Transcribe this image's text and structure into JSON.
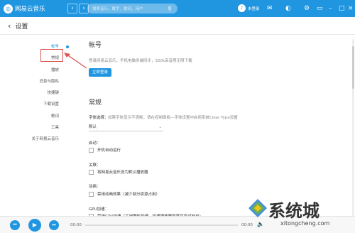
{
  "titlebar": {
    "app_name": "网易云音乐",
    "back_arrow": "‹",
    "forward_arrow": "›",
    "search_placeholder": "搜索音乐，歌手，歌词，用户",
    "avatar_text": "♪",
    "username": "未登录",
    "bg_color": "#2196e0"
  },
  "header": {
    "back_icon": "‹",
    "title": "设置"
  },
  "sidebar": {
    "items": [
      {
        "label": "帐号",
        "active": true
      },
      {
        "label": "常规",
        "active": false
      },
      {
        "label": "播放",
        "active": false
      },
      {
        "label": "消息与隐私",
        "active": false
      },
      {
        "label": "快捷键",
        "active": false
      },
      {
        "label": "下载设置",
        "active": false
      },
      {
        "label": "歌词",
        "active": false
      },
      {
        "label": "工具",
        "active": false
      },
      {
        "label": "关于网易云音乐",
        "active": false
      }
    ]
  },
  "account": {
    "title": "帐号",
    "desc": "登录网易云音乐，手机电脑多端同步，320k高音质无限下载",
    "login_button": "立即登录"
  },
  "general": {
    "title": "常规",
    "font_label": "字体选择：",
    "font_note": "如果字体显示不清晰，请在控制面板—字体设置中启用系统Clear Type设置",
    "font_value": "默认",
    "startup_label": "启动：",
    "startup_option": "开机自动运行",
    "assoc_label": "关联：",
    "assoc_option": "将网易云音乐设为默认播放器",
    "anim_label": "动画：",
    "anim_option": "禁用动画效果（减少部分资源占用）",
    "gpu_label": "GPU加速：",
    "gpu_option": "禁用GPU加速（关闭图形加速，如遇播放器异常可尝试开启）"
  },
  "player": {
    "time_current": "00:00",
    "time_total": "00:00",
    "progress": 0
  },
  "watermark": {
    "text": "系统城",
    "url": "xitongcheng.com"
  }
}
